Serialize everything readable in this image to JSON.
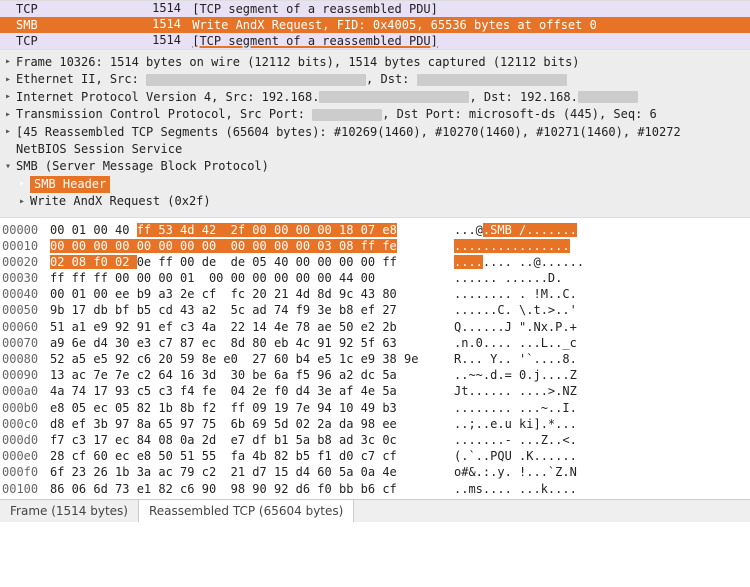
{
  "packet_list": [
    {
      "proto": "TCP",
      "len": "1514",
      "info": "[TCP segment of a reassembled PDU]",
      "style": "tcp",
      "underline_info": false
    },
    {
      "proto": "SMB",
      "len": "1514",
      "info": "Write AndX Request, FID: 0x4005, 65536 bytes at offset 0",
      "style": "smb",
      "underline_info": false
    },
    {
      "proto": "TCP",
      "len": "1514",
      "info": "[TCP segment of a reassembled PDU]",
      "style": "tcp",
      "underline_info": true
    }
  ],
  "details": {
    "frame": "Frame 10326: 1514 bytes on wire (12112 bits), 1514 bytes captured (12112 bits)",
    "eth_prefix": "Ethernet II, Src: ",
    "eth_mid": ", Dst: ",
    "ip_prefix": "Internet Protocol Version 4, Src: 192.168.",
    "ip_mid": ", Dst: 192.168.",
    "tcp_prefix": "Transmission Control Protocol, Src Port: ",
    "tcp_mid": ", Dst Port: microsoft-ds (445), Seq: 6",
    "reasm": "[45 Reassembled TCP Segments (65604 bytes): #10269(1460), #10270(1460), #10271(1460), #10272",
    "netbios": "NetBIOS Session Service",
    "smb": "SMB (Server Message Block Protocol)",
    "smb_header": "SMB Header",
    "write": "Write AndX Request (0x2f)"
  },
  "hex": [
    {
      "off": "00000",
      "pre": "00 01 00 40 ",
      "hl": "ff 53 4d 42  2f 00 00 00 00 18 07 e8",
      "post": "",
      "asc_pre": "...@",
      "asc_hl": ".SMB /.......",
      "asc_post": ""
    },
    {
      "off": "00010",
      "pre": "",
      "hl": "00 00 00 00 00 00 00 00  00 00 00 00 03 08 ff fe",
      "post": "",
      "asc_pre": "",
      "asc_hl": "................",
      "asc_post": ""
    },
    {
      "off": "00020",
      "pre": "",
      "hl": "02 08 f0 02 ",
      "post": "0e ff 00 de  de 05 40 00 00 00 00 ff",
      "asc_pre": "",
      "asc_hl": "....",
      "asc_post": ".... ..@......"
    },
    {
      "off": "00030",
      "pre": "",
      "hl": "",
      "post": "ff ff ff 00 00 00 01  00 00 00 00 00 00 44 00",
      "asc_pre": "",
      "asc_hl": "",
      "asc_post": "...... ......D."
    },
    {
      "off": "00040",
      "pre": "",
      "hl": "",
      "post": "00 01 00 ee b9 a3 2e cf  fc 20 21 4d 8d 9c 43 80",
      "asc_pre": "",
      "asc_hl": "",
      "asc_post": "........ . !M..C."
    },
    {
      "off": "00050",
      "pre": "",
      "hl": "",
      "post": "9b 17 db bf b5 cd 43 a2  5c ad 74 f9 3e b8 ef 27",
      "asc_pre": "",
      "asc_hl": "",
      "asc_post": "......C. \\.t.>..'"
    },
    {
      "off": "00060",
      "pre": "",
      "hl": "",
      "post": "51 a1 e9 92 91 ef c3 4a  22 14 4e 78 ae 50 e2 2b",
      "asc_pre": "",
      "asc_hl": "",
      "asc_post": "Q......J \".Nx.P.+"
    },
    {
      "off": "00070",
      "pre": "",
      "hl": "",
      "post": "a9 6e d4 30 e3 c7 87 ec  8d 80 eb 4c 91 92 5f 63",
      "asc_pre": "",
      "asc_hl": "",
      "asc_post": ".n.0.... ...L.._c"
    },
    {
      "off": "00080",
      "pre": "",
      "hl": "",
      "post": "52 a5 e5 92 c6 20 59 8e e0  27 60 b4 e5 1c e9 38 9e",
      "asc_pre": "",
      "asc_hl": "",
      "asc_post": "R... Y.. '`....8."
    },
    {
      "off": "00090",
      "pre": "",
      "hl": "",
      "post": "13 ac 7e 7e c2 64 16 3d  30 be 6a f5 96 a2 dc 5a",
      "asc_pre": "",
      "asc_hl": "",
      "asc_post": "..~~.d.= 0.j....Z"
    },
    {
      "off": "000a0",
      "pre": "",
      "hl": "",
      "post": "4a 74 17 93 c5 c3 f4 fe  04 2e f0 d4 3e af 4e 5a",
      "asc_pre": "",
      "asc_hl": "",
      "asc_post": "Jt...... ....>.NZ"
    },
    {
      "off": "000b0",
      "pre": "",
      "hl": "",
      "post": "e8 05 ec 05 82 1b 8b f2  ff 09 19 7e 94 10 49 b3",
      "asc_pre": "",
      "asc_hl": "",
      "asc_post": "........ ...~..I."
    },
    {
      "off": "000c0",
      "pre": "",
      "hl": "",
      "post": "d8 ef 3b 97 8a 65 97 75  6b 69 5d 02 2a da 98 ee",
      "asc_pre": "",
      "asc_hl": "",
      "asc_post": "..;..e.u ki].*..."
    },
    {
      "off": "000d0",
      "pre": "",
      "hl": "",
      "post": "f7 c3 17 ec 84 08 0a 2d  e7 df b1 5a b8 ad 3c 0c",
      "asc_pre": "",
      "asc_hl": "",
      "asc_post": ".......- ...Z..<."
    },
    {
      "off": "000e0",
      "pre": "",
      "hl": "",
      "post": "28 cf 60 ec e8 50 51 55  fa 4b 82 b5 f1 d0 c7 cf",
      "asc_pre": "",
      "asc_hl": "",
      "asc_post": "(.`..PQU .K......"
    },
    {
      "off": "000f0",
      "pre": "",
      "hl": "",
      "post": "6f 23 26 1b 3a ac 79 c2  21 d7 15 d4 60 5a 0a 4e",
      "asc_pre": "",
      "asc_hl": "",
      "asc_post": "o#&.:.y. !...`Z.N"
    },
    {
      "off": "00100",
      "pre": "",
      "hl": "",
      "post": "86 06 6d 73 e1 82 c6 90  98 90 92 d6 f0 bb b6 cf",
      "asc_pre": "",
      "asc_hl": "",
      "asc_post": "..ms.... ...k...."
    }
  ],
  "tabs": {
    "frame": "Frame (1514 bytes)",
    "reasm": "Reassembled TCP (65604 bytes)"
  }
}
